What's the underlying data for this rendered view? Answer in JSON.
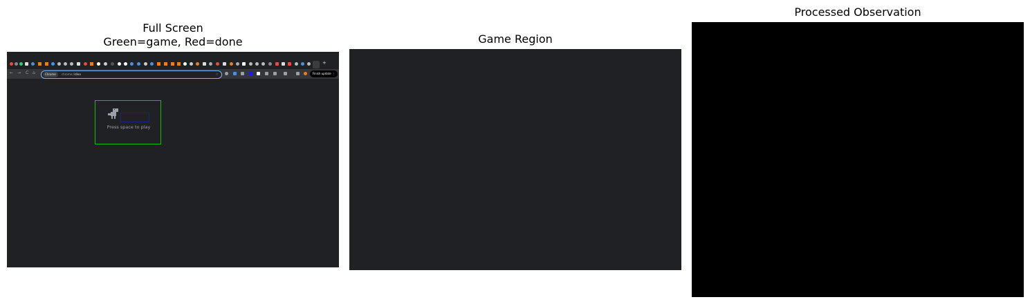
{
  "panels": {
    "full_screen": {
      "title_line1": "Full Screen",
      "title_line2": "Green=game, Red=done"
    },
    "game_region": {
      "title": "Game Region"
    },
    "processed": {
      "title": "Processed Observation"
    }
  },
  "browser": {
    "site_chip": "Chrome",
    "url_prefix": "chrome://",
    "url_path": "dino",
    "new_tab_glyph": "+",
    "finish_update": "Finish update ⋮",
    "nav_back": "←",
    "nav_forward": "→",
    "nav_reload": "C",
    "nav_home": "⌂",
    "bookmark_star": "☆"
  },
  "game": {
    "prompt": "Press space to play"
  },
  "colors": {
    "game_box": "#12c012",
    "done_box": "#1a237e",
    "dark_bg": "#202124",
    "obs_bg": "#000000"
  }
}
